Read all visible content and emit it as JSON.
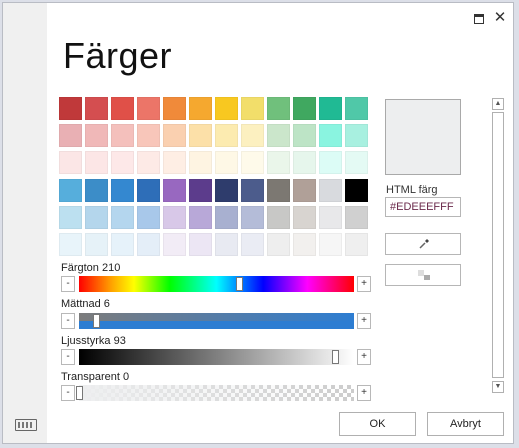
{
  "dialog": {
    "title": "Färger",
    "titlebar": {
      "maximize_icon": "maximize-icon",
      "close_glyph": "✕"
    }
  },
  "palette": {
    "rows": [
      [
        "#C0393A",
        "#D44E50",
        "#E05048",
        "#EC7568",
        "#F08A3A",
        "#F5A82F",
        "#F8C820",
        "#F2DE6A",
        "#70C07C",
        "#40A860",
        "#20BA94",
        "#50C8A8"
      ],
      [
        "#E9B0B4",
        "#F0B8B8",
        "#F4C0BC",
        "#F8C6BA",
        "#FAD0B0",
        "#FCE0A8",
        "#FCEBB0",
        "#FCF0C0",
        "#CBE6CB",
        "#BDE4C6",
        "#8AF4E0",
        "#A8F0E0"
      ],
      [
        "#FBE6E6",
        "#FCE6E6",
        "#FDE8E8",
        "#FDEAE6",
        "#FEEEE4",
        "#FEF4E2",
        "#FEF8E6",
        "#FEFAEA",
        "#EAF6EA",
        "#E6F6EC",
        "#DCFCF6",
        "#E4FAF4"
      ],
      [
        "#56AEDC",
        "#3C8DC8",
        "#3488D0",
        "#2E6EB8",
        "#9868C0",
        "#5C3C8C",
        "#2E3C6C",
        "#4C5C8C",
        "#7C7872",
        "#B0A098",
        "#D8DADE",
        "#000000"
      ],
      [
        "#BCE0F0",
        "#B4D6EC",
        "#B4D6EE",
        "#A8C8EA",
        "#D8C8E8",
        "#B8A8D8",
        "#A8B0D0",
        "#B4BCD8",
        "#C8C8C6",
        "#D8D4D0",
        "#E8E8EA",
        "#D0D0D0"
      ],
      [
        "#E8F4FA",
        "#E6F2F8",
        "#E6F2FA",
        "#E4EEF8",
        "#F2ECF6",
        "#ECE6F4",
        "#E8EAF2",
        "#EAECF4",
        "#EEEEEE",
        "#F2F0EE",
        "#F6F6F6",
        "#EFEFEF"
      ]
    ]
  },
  "sliders": {
    "hue": {
      "label": "Färgton 210",
      "minus": "-",
      "plus": "+",
      "value": 0.58
    },
    "saturation": {
      "label": "Mättnad 6",
      "minus": "-",
      "plus": "+",
      "value": 0.06
    },
    "lightness": {
      "label": "Ljusstyrka 93",
      "minus": "-",
      "plus": "+",
      "value": 0.93
    },
    "transparency": {
      "label": "Transparent 0",
      "minus": "-",
      "plus": "+",
      "value": 0.0
    }
  },
  "preview": {
    "color": "#EDEEEF"
  },
  "html_color": {
    "label": "HTML färg",
    "value": "#EDEEEFFF"
  },
  "tools": {
    "eyedropper_icon": "eyedropper-icon",
    "no_color_icon": "no-color-icon"
  },
  "scrollbar": {
    "up": "▲",
    "down": "▼"
  },
  "footer": {
    "ok_label": "OK",
    "cancel_label": "Avbryt",
    "keyboard_icon": "keyboard-icon"
  },
  "colors": {
    "accent_blue": "#2D7DD2",
    "track_gray": "#6E6E6E"
  }
}
